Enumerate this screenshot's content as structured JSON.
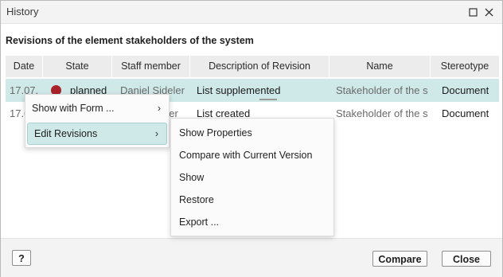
{
  "window": {
    "title": "History"
  },
  "heading": "Revisions of the element stakeholders of the system",
  "table": {
    "columns": [
      "Date",
      "State",
      "Staff member",
      "Description of Revision",
      "Name",
      "Stereotype"
    ],
    "rows": [
      {
        "date": "17.07.",
        "state": "planned",
        "staff": "Daniel Sideler",
        "description": "List supplemented",
        "name": "Stakeholder of the s",
        "stereotype": "Document"
      },
      {
        "date": "17.0",
        "state": "",
        "staff": "der",
        "description": "List created",
        "name": "Stakeholder of the s",
        "stereotype": "Document"
      }
    ]
  },
  "context_menu": {
    "items": [
      {
        "label": "Show with Form ...",
        "chevron": "›"
      },
      {
        "label": "Edit Revisions",
        "chevron": "›"
      }
    ]
  },
  "submenu": {
    "items": [
      "Show Properties",
      "Compare with Current Version",
      "Show",
      "Restore",
      "Export ..."
    ]
  },
  "footer": {
    "help_label": "?",
    "compare_label": "Compare",
    "close_label": "Close"
  },
  "colors": {
    "selection": "#cfe8e8",
    "state_planned": "#a8232a"
  }
}
